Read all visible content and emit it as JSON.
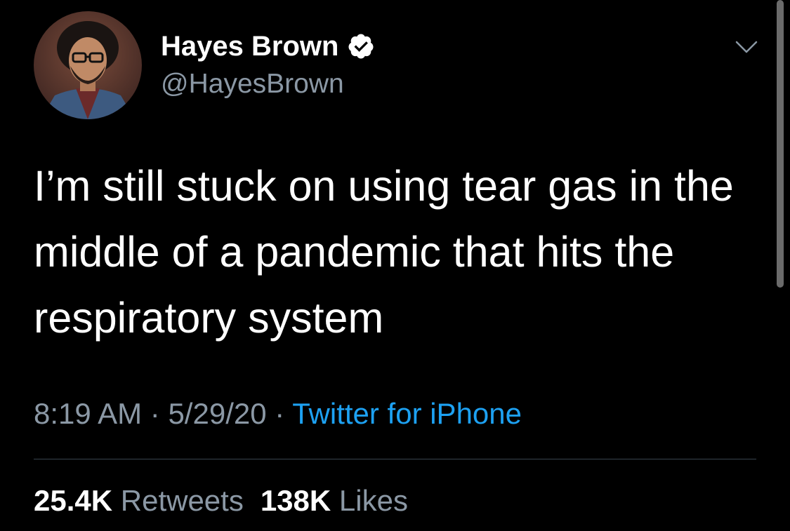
{
  "user": {
    "display_name": "Hayes Brown",
    "handle": "@HayesBrown",
    "verified": true
  },
  "tweet": {
    "text_lines": [
      "I’m still stuck on using tear gas in the",
      "middle of a pandemic that hits the",
      "respiratory system"
    ],
    "time": "8:19 AM",
    "date": "5/29/20",
    "separator": "·",
    "source": "Twitter for iPhone"
  },
  "stats": {
    "retweets_count": "25.4K",
    "retweets_label": "Retweets",
    "likes_count": "138K",
    "likes_label": "Likes"
  },
  "colors": {
    "background": "#000000",
    "text": "#ffffff",
    "secondary_text": "#8b98a5",
    "link": "#1da1f2",
    "verified_badge": "#ffffff"
  },
  "icons": {
    "verified": "verified-badge-icon",
    "more": "chevron-down-icon"
  }
}
